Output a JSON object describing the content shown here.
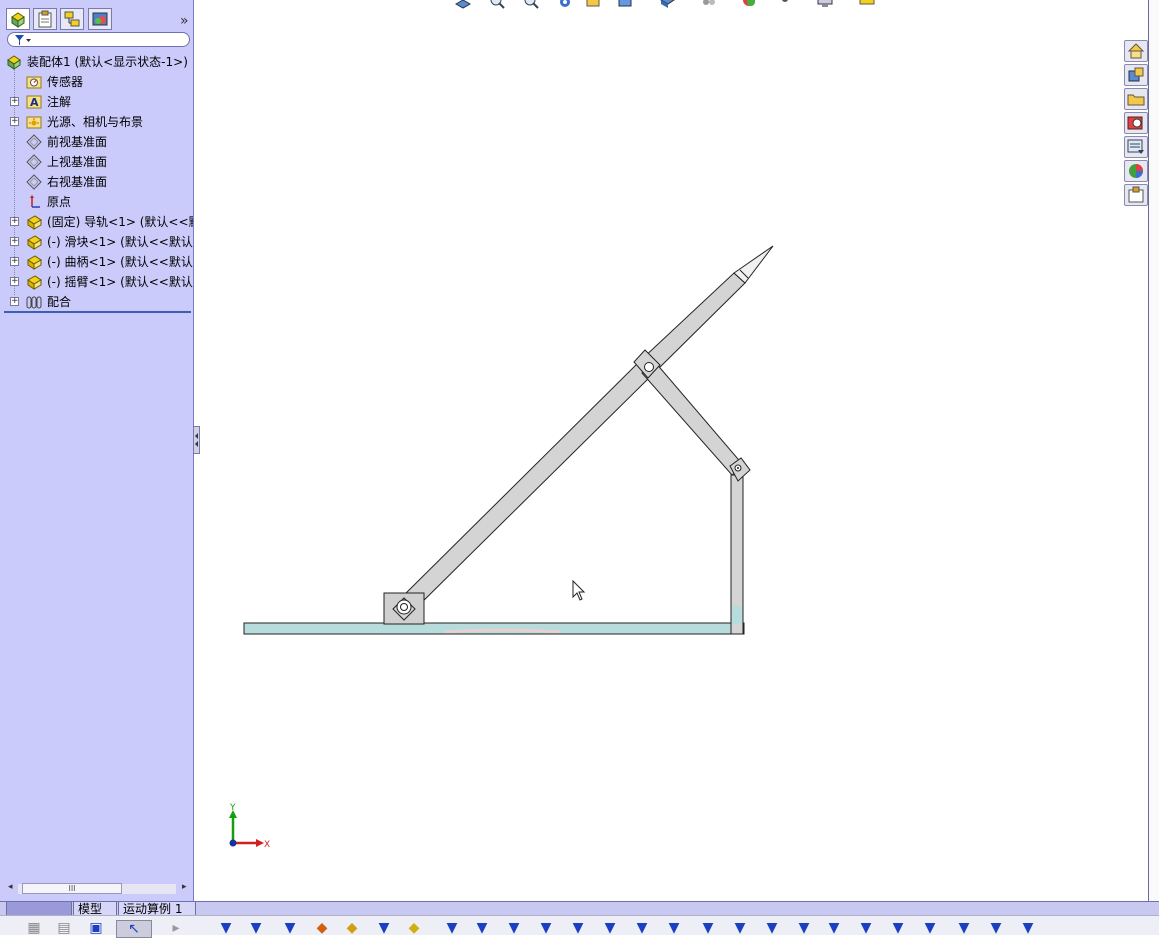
{
  "feature_tree": {
    "root": "装配体1  (默认<显示状态-1>)",
    "items": [
      {
        "label": "传感器",
        "expandable": false,
        "icon": "sensor-icon"
      },
      {
        "label": "注解",
        "expandable": true,
        "icon": "annotation-icon"
      },
      {
        "label": "光源、相机与布景",
        "expandable": true,
        "icon": "lights-cameras-icon"
      },
      {
        "label": "前视基准面",
        "expandable": false,
        "icon": "plane-icon"
      },
      {
        "label": "上视基准面",
        "expandable": false,
        "icon": "plane-icon"
      },
      {
        "label": "右视基准面",
        "expandable": false,
        "icon": "plane-icon"
      },
      {
        "label": "原点",
        "expandable": false,
        "icon": "origin-icon"
      },
      {
        "label": "(固定) 导轨<1> (默认<<默",
        "expandable": true,
        "icon": "part-icon"
      },
      {
        "label": "(-) 滑块<1> (默认<<默认:",
        "expandable": true,
        "icon": "part-icon"
      },
      {
        "label": "(-) 曲柄<1> (默认<<默认:",
        "expandable": true,
        "icon": "part-icon"
      },
      {
        "label": "(-) 摇臂<1> (默认<<默认:",
        "expandable": true,
        "icon": "part-icon"
      },
      {
        "label": "配合",
        "expandable": true,
        "icon": "mates-icon"
      }
    ]
  },
  "bottom_tabs": {
    "model": "模型",
    "motion": "运动算例 1"
  },
  "scroll": {
    "thumb": "III"
  },
  "panel": {
    "expand": "»"
  },
  "axes": {
    "x": "X",
    "y": "Y"
  },
  "colors": {
    "panel_bg": "#cbcbfb",
    "link_fill": "#d4d4d4",
    "rail_fill": "#b8dcdc",
    "triad_x": "#d02020",
    "triad_y": "#10a010",
    "triad_origin": "#1a2fa0"
  }
}
